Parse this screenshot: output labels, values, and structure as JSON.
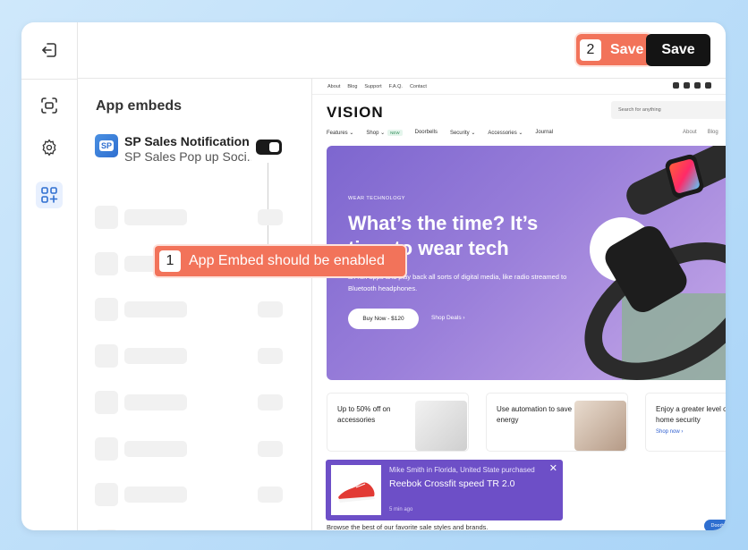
{
  "topbar": {
    "save_label": "Save",
    "callout2_num": "2",
    "callout2_label": "Save"
  },
  "panel": {
    "title": "App embeds",
    "app_name": "SP Sales Notification",
    "app_subtitle": "SP Sales Pop up Soci...",
    "app_logo_text": "SP",
    "toggle_state": "on",
    "callout1_num": "1",
    "callout1_label": "App Embed should be enabled"
  },
  "rail": {
    "icons": [
      "exit-icon",
      "select-icon",
      "gear-icon",
      "apps-icon"
    ]
  },
  "preview": {
    "util_links": [
      "About",
      "Blog",
      "Support",
      "F.A.Q.",
      "Contact"
    ],
    "logo": "VISION",
    "search_placeholder": "Search for anything",
    "nav": [
      "Features",
      "Shop",
      "Doorbells",
      "Security",
      "Accessories",
      "Journal"
    ],
    "new_badge": "NEW",
    "nav_right": [
      "About",
      "Blog"
    ],
    "hero": {
      "kicker": "WEAR TECHNOLOGY",
      "title": "What’s the time? It’s time to wear tech",
      "body": "an run apps and play back all sorts of digital media, like radio streamed to Bluetooth headphones.",
      "cta": "Buy Now - $120",
      "link": "Shop Deals"
    },
    "cards": [
      {
        "text": "Up to 50% off on accessories"
      },
      {
        "text": "Use automation to save energy"
      },
      {
        "text": "Enjoy a greater level of home security",
        "link": "Shop now"
      }
    ],
    "browse_text": "Browse the best of our favorite sale styles and brands.",
    "pill_text": "Doorb"
  },
  "toast": {
    "line1": "Mike Smith in Florida, United State purchased",
    "product": "Reebok Crossfit speed TR 2.0",
    "time": "5 min ago",
    "close": "✕"
  },
  "colors": {
    "accent_callout": "#f2735a",
    "toast_bg": "#6d4fc7",
    "save_bg": "#141414"
  }
}
